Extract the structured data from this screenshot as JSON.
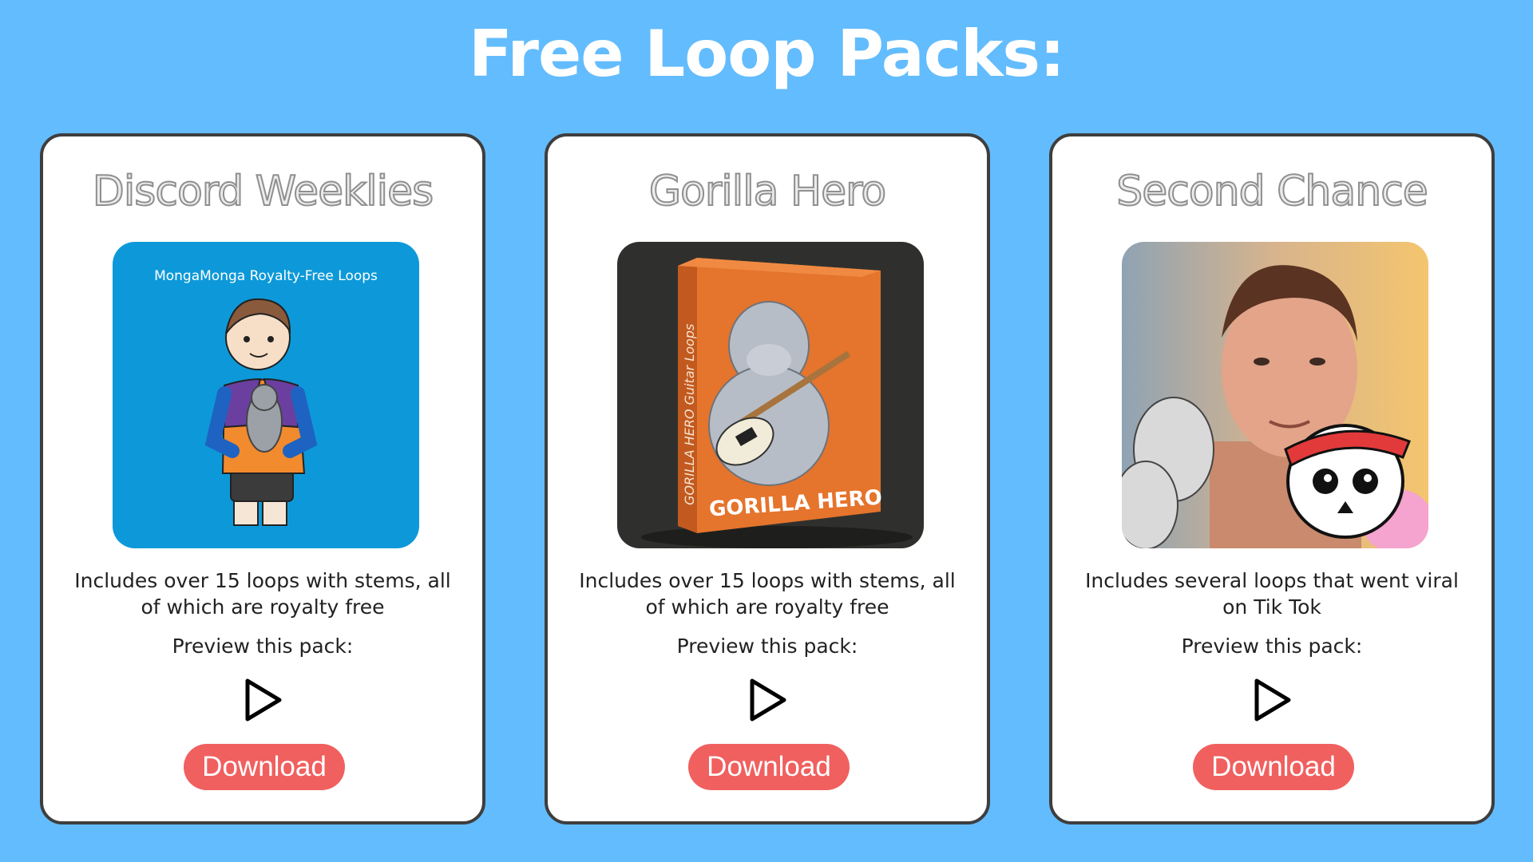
{
  "page": {
    "title": "Free Loop Packs:"
  },
  "cards": [
    {
      "title": "Discord Weeklies",
      "thumb_text": "MongaMonga Royalty-Free Loops",
      "description": "Includes over 15 loops with stems, all of which are royalty free",
      "preview_label": "Preview this pack:",
      "download_label": "Download"
    },
    {
      "title": "Gorilla Hero",
      "thumb_box_label": "GORILLA HERO",
      "thumb_side_label": "GORILLA HERO Guitar Loops",
      "description": "Includes over 15 loops with stems, all of which are royalty free",
      "preview_label": "Preview this pack:",
      "download_label": "Download"
    },
    {
      "title": "Second Chance",
      "description": "Includes several loops that went viral on Tik Tok",
      "preview_label": "Preview this pack:",
      "download_label": "Download"
    }
  ],
  "icons": {
    "play": "play-icon"
  },
  "colors": {
    "background": "#63bcfd",
    "download_button": "#f0605f",
    "card_border": "#3e3e3e"
  }
}
